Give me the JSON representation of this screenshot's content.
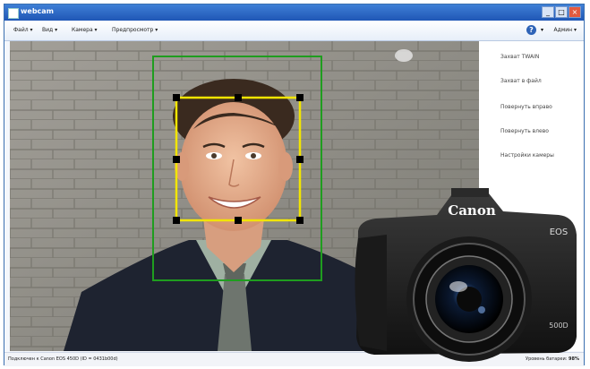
{
  "window": {
    "title": "webcam"
  },
  "menu": {
    "items": [
      "Файл ▾",
      "Вид ▾",
      "Камера ▾",
      "Предпросмотр ▾"
    ],
    "admin": "Админ ▾"
  },
  "actions": [
    "Захват TWAIN",
    "Захват в файл",
    "Повернуть вправо",
    "Повернуть влево",
    "Настройки камеры"
  ],
  "status": {
    "connection": "Подключен к Canon EOS 450D (ID = 0431b00d)",
    "battery_label": "Уровень батареи:",
    "battery_value": "98%"
  },
  "camera": {
    "brand": "Canon",
    "model": "EOS",
    "model_sub": "500D"
  },
  "colors": {
    "face_frame": "#f2e500",
    "detect_frame": "#1f9d1f",
    "title_bar": "#1f56b5"
  }
}
